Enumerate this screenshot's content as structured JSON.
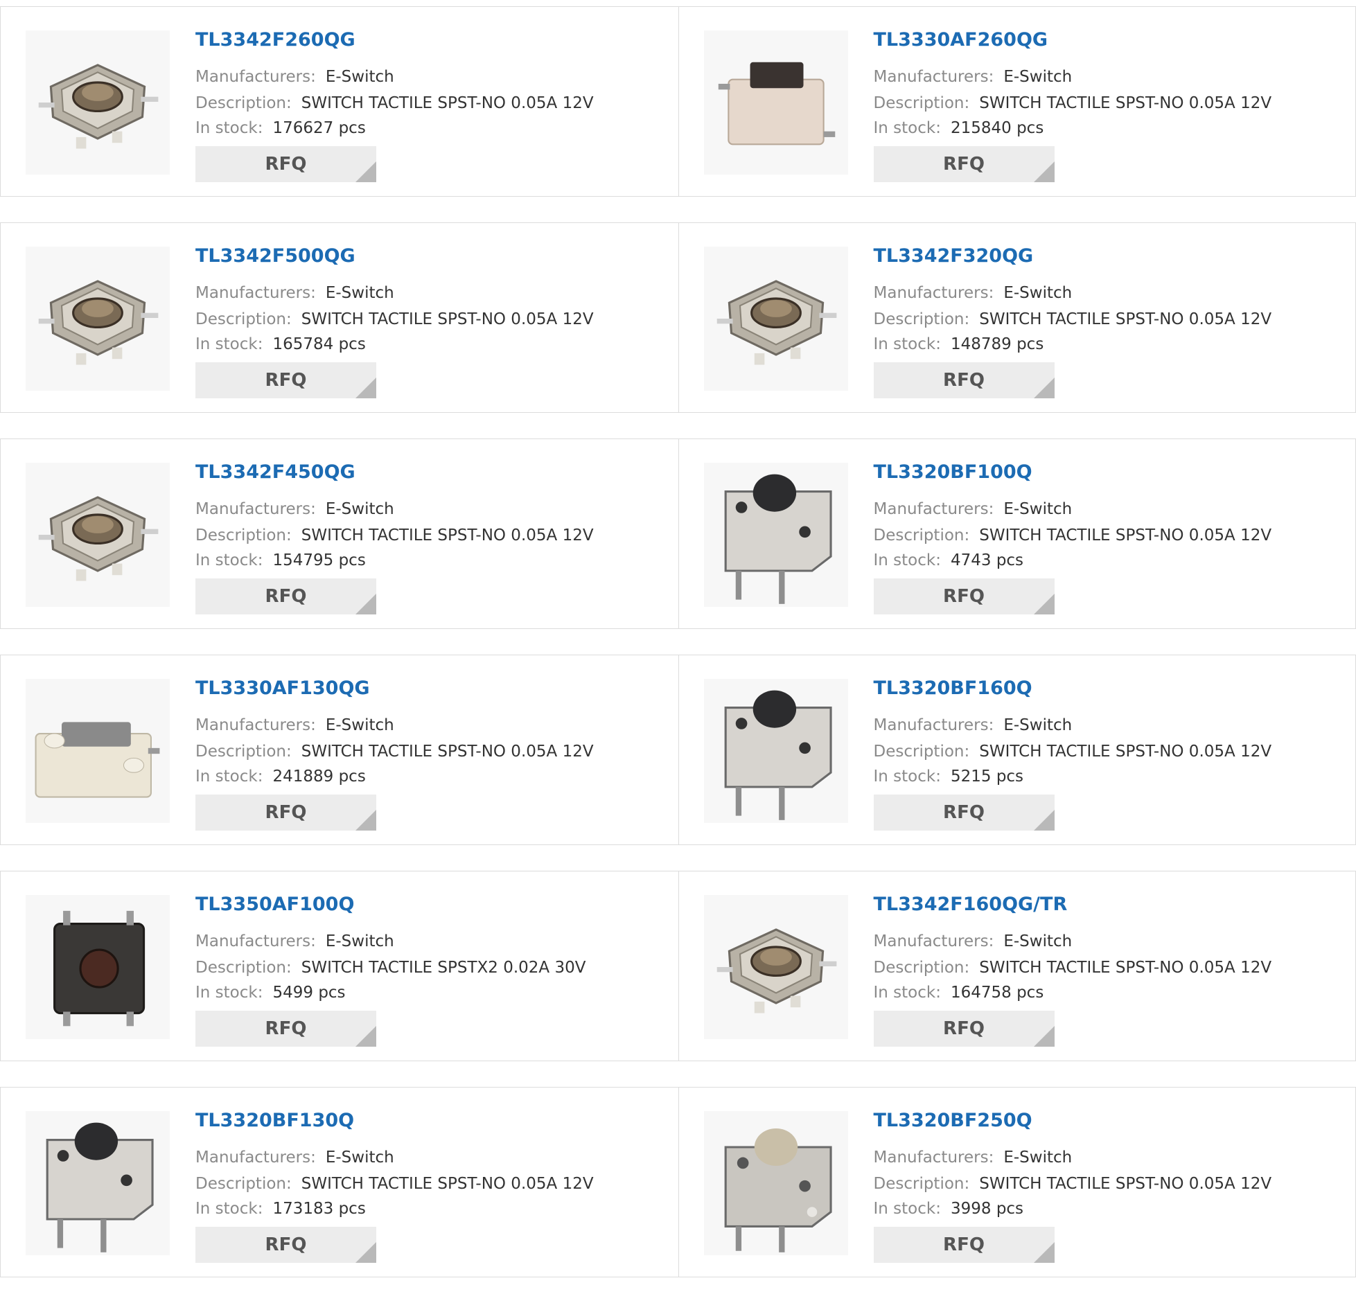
{
  "labels": {
    "manufacturers": "Manufacturers:",
    "description": "Description:",
    "in_stock": "In stock:",
    "rfq": "RFQ"
  },
  "products": [
    {
      "part": "TL3342F260QG",
      "manufacturer": "E-Switch",
      "description": "SWITCH TACTILE SPST-NO 0.05A 12V",
      "stock": "176627 pcs",
      "image": "smd-square-switch-image"
    },
    {
      "part": "TL3330AF260QG",
      "manufacturer": "E-Switch",
      "description": "SWITCH TACTILE SPST-NO 0.05A 12V",
      "stock": "215840 pcs",
      "image": "side-actuated-switch-image"
    },
    {
      "part": "TL3342F500QG",
      "manufacturer": "E-Switch",
      "description": "SWITCH TACTILE SPST-NO 0.05A 12V",
      "stock": "165784 pcs",
      "image": "smd-square-switch-image"
    },
    {
      "part": "TL3342F320QG",
      "manufacturer": "E-Switch",
      "description": "SWITCH TACTILE SPST-NO 0.05A 12V",
      "stock": "148789 pcs",
      "image": "smd-square-switch-image"
    },
    {
      "part": "TL3342F450QG",
      "manufacturer": "E-Switch",
      "description": "SWITCH TACTILE SPST-NO 0.05A 12V",
      "stock": "154795 pcs",
      "image": "smd-square-switch-image"
    },
    {
      "part": "TL3320BF100Q",
      "manufacturer": "E-Switch",
      "description": "SWITCH TACTILE SPST-NO 0.05A 12V",
      "stock": "4743 pcs",
      "image": "right-angle-switch-image"
    },
    {
      "part": "TL3330AF130QG",
      "manufacturer": "E-Switch",
      "description": "SWITCH TACTILE SPST-NO 0.05A 12V",
      "stock": "241889 pcs",
      "image": "side-actuated-gray-switch-image"
    },
    {
      "part": "TL3320BF160Q",
      "manufacturer": "E-Switch",
      "description": "SWITCH TACTILE SPST-NO 0.05A 12V",
      "stock": "5215 pcs",
      "image": "right-angle-switch-image"
    },
    {
      "part": "TL3350AF100Q",
      "manufacturer": "E-Switch",
      "description": "SWITCH TACTILE SPSTX2 0.02A 30V",
      "stock": "5499 pcs",
      "image": "black-square-switch-image"
    },
    {
      "part": "TL3342F160QG/TR",
      "manufacturer": "E-Switch",
      "description": "SWITCH TACTILE SPST-NO 0.05A 12V",
      "stock": "164758 pcs",
      "image": "smd-square-switch-image"
    },
    {
      "part": "TL3320BF130Q",
      "manufacturer": "E-Switch",
      "description": "SWITCH TACTILE SPST-NO 0.05A 12V",
      "stock": "173183 pcs",
      "image": "right-angle-switch-image"
    },
    {
      "part": "TL3320BF250Q",
      "manufacturer": "E-Switch",
      "description": "SWITCH TACTILE SPST-NO 0.05A 12V",
      "stock": "3998 pcs",
      "image": "right-angle-beige-switch-image"
    }
  ]
}
